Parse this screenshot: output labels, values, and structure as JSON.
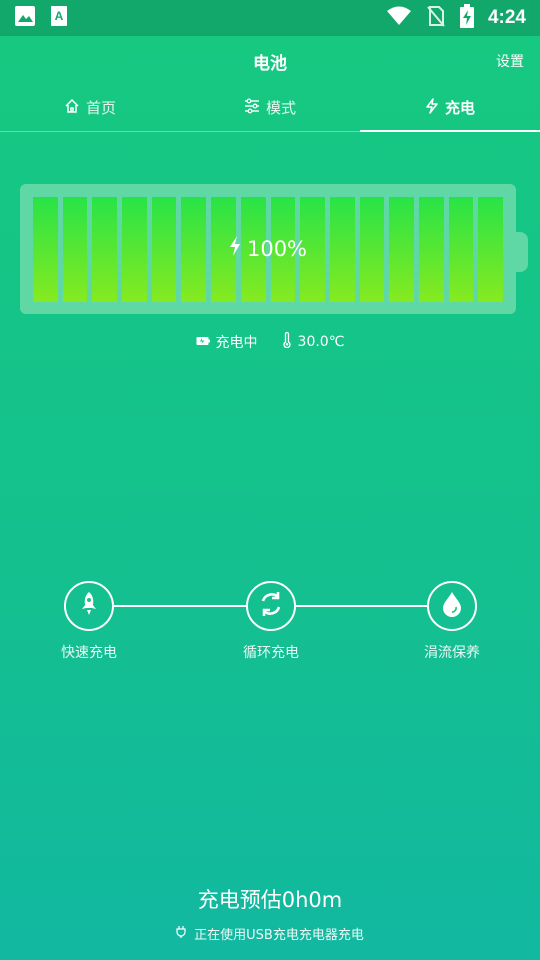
{
  "status_bar": {
    "time": "4:24",
    "left_icons": [
      "image-icon",
      "text-a-icon"
    ],
    "right_icons": [
      "wifi-icon",
      "no-sim-icon",
      "battery-charging-icon"
    ]
  },
  "app_bar": {
    "title": "电池",
    "settings_label": "设置"
  },
  "tabs": [
    {
      "label": "首页",
      "icon": "home-icon",
      "active": false
    },
    {
      "label": "模式",
      "icon": "sliders-icon",
      "active": false
    },
    {
      "label": "充电",
      "icon": "lightning-icon",
      "active": true
    }
  ],
  "battery": {
    "level_text": "100%",
    "level": 1.0,
    "cell_count": 16
  },
  "info": {
    "status_label": "充电中",
    "temperature": "30.0℃"
  },
  "steps": [
    {
      "label": "快速充电",
      "icon": "rocket-icon"
    },
    {
      "label": "循环充电",
      "icon": "cycle-icon"
    },
    {
      "label": "涓流保养",
      "icon": "water-drop-icon"
    }
  ],
  "footer": {
    "estimate": "充电预估0h0m",
    "charger_note": "正在使用USB充电充电器充电"
  },
  "colors": {
    "status_bar": "#12a86c",
    "background_top": "#16c97f",
    "background_bottom": "#12b8a0",
    "battery_frame": "#5fd8a6",
    "cell_top": "#28e347",
    "cell_bottom": "#86ea20"
  }
}
